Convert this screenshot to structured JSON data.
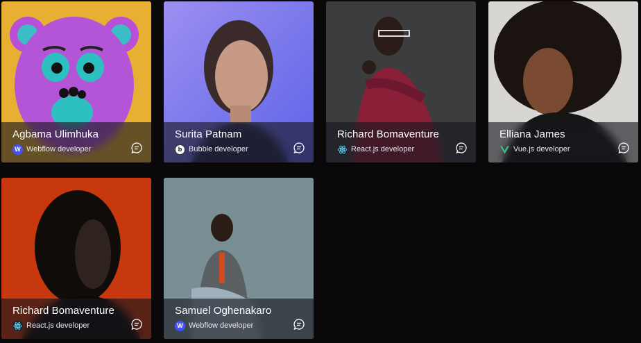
{
  "developers": [
    {
      "name": "Agbama Ulimhuka",
      "role": "Webflow developer",
      "platform_icon": "webflow-icon"
    },
    {
      "name": "Surita Patnam",
      "role": "Bubble developer",
      "platform_icon": "bubble-icon"
    },
    {
      "name": "Richard Bomaventure",
      "role": "React.js developer",
      "platform_icon": "react-icon"
    },
    {
      "name": "Elliana James",
      "role": "Vue.js developer",
      "platform_icon": "vue-icon"
    },
    {
      "name": "Richard Bomaventure",
      "role": "React.js developer",
      "platform_icon": "react-icon"
    },
    {
      "name": "Samuel Oghenakaro",
      "role": "Webflow developer",
      "platform_icon": "webflow-icon"
    }
  ],
  "badge_letters": {
    "webflow": "W",
    "bubble": "b"
  },
  "colors": {
    "background": "#0a0808",
    "webflow": "#4353ff",
    "react": "#61dafb",
    "vue": "#41b883"
  },
  "chat_icon": "message-icon"
}
